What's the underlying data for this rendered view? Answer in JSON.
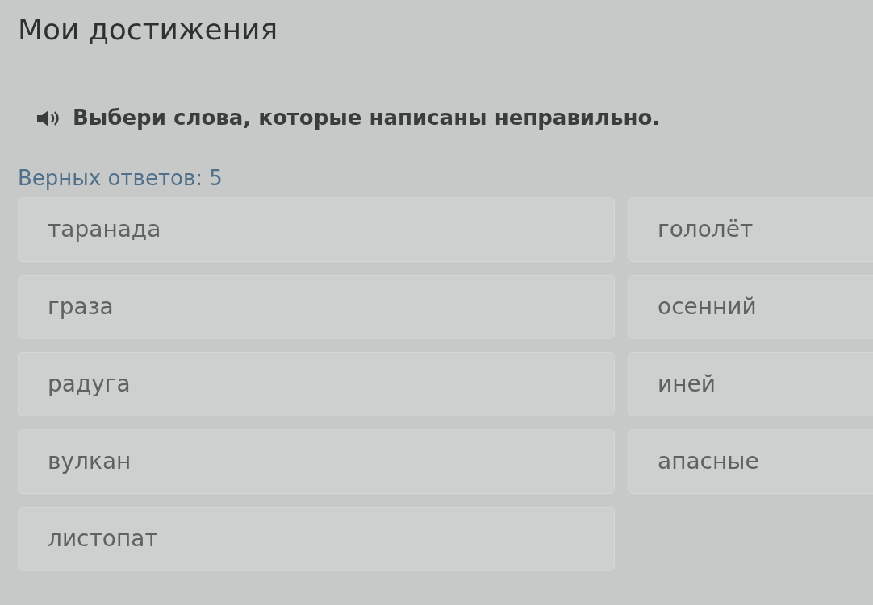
{
  "page": {
    "title": "Мои достижения"
  },
  "question": {
    "text": "Выбери слова, которые написаны неправильно."
  },
  "answer_count": "Верных ответов: 5",
  "options_left": [
    {
      "label": "таранада",
      "selected": false
    },
    {
      "label": "граза",
      "selected": false
    },
    {
      "label": "радуга",
      "selected": false
    },
    {
      "label": "вулкан",
      "selected": false
    },
    {
      "label": "листопат",
      "selected": false
    }
  ],
  "options_right": [
    {
      "label": "гололёт",
      "selected": false
    },
    {
      "label": "осенний",
      "selected": false
    },
    {
      "label": "иней",
      "selected": false
    },
    {
      "label": "апасные",
      "selected": false
    }
  ]
}
